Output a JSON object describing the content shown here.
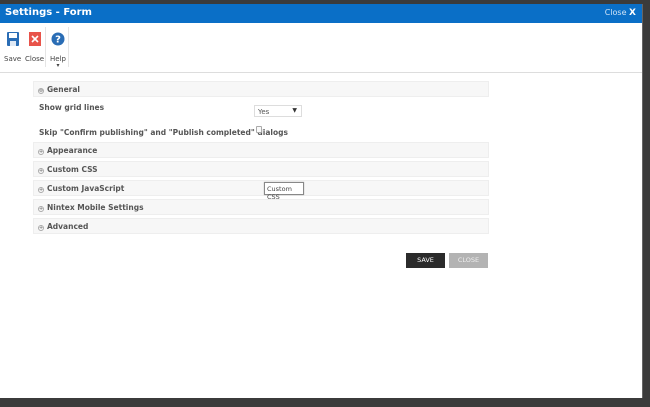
{
  "window": {
    "title": "Settings - Form",
    "close_label": "Close",
    "close_x": "X"
  },
  "toolbar": {
    "save": "Save",
    "close": "Close",
    "help": "Help",
    "help_arrow": "▾"
  },
  "general": {
    "label": "General",
    "icon": "⊖",
    "show_grid_lines": "Show grid lines",
    "grid_value": "Yes",
    "grid_arrow": "▼",
    "skip_label": "Skip \"Confirm publishing\" and \"Publish completed\" dialogs"
  },
  "sections": [
    {
      "label": "Appearance"
    },
    {
      "label": "Custom CSS"
    },
    {
      "label": "Custom JavaScript"
    },
    {
      "label": "Nintex Mobile Settings"
    },
    {
      "label": "Advanced"
    }
  ],
  "expand_icon": "+",
  "tooltip": "Custom CSS",
  "buttons": {
    "save": "SAVE",
    "close": "CLOSE"
  }
}
